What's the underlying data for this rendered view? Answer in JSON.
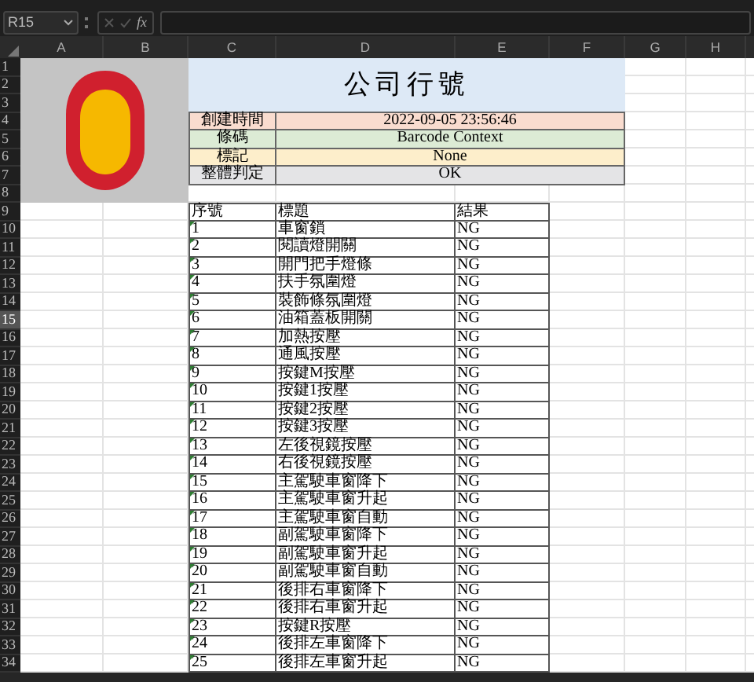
{
  "name_box": {
    "value": "R15"
  },
  "formula_bar": {
    "function_label": "fx"
  },
  "column_headers": [
    "A",
    "B",
    "C",
    "D",
    "E",
    "F",
    "G",
    "H"
  ],
  "row_headers": [
    {
      "label": "1",
      "selected": false
    },
    {
      "label": "2",
      "selected": false
    },
    {
      "label": "3",
      "selected": false
    },
    {
      "label": "4",
      "selected": false
    },
    {
      "label": "5",
      "selected": false
    },
    {
      "label": "6",
      "selected": false
    },
    {
      "label": "7",
      "selected": false
    },
    {
      "label": "8",
      "selected": false
    },
    {
      "label": "9",
      "selected": false
    },
    {
      "label": "10",
      "selected": false
    },
    {
      "label": "11",
      "selected": false
    },
    {
      "label": "12",
      "selected": false
    },
    {
      "label": "13",
      "selected": false
    },
    {
      "label": "14",
      "selected": false
    },
    {
      "label": "15",
      "selected": true
    },
    {
      "label": "16",
      "selected": false
    },
    {
      "label": "17",
      "selected": false
    },
    {
      "label": "18",
      "selected": false
    },
    {
      "label": "19",
      "selected": false
    },
    {
      "label": "20",
      "selected": false
    },
    {
      "label": "21",
      "selected": false
    },
    {
      "label": "22",
      "selected": false
    },
    {
      "label": "23",
      "selected": false
    },
    {
      "label": "24",
      "selected": false
    },
    {
      "label": "25",
      "selected": false
    },
    {
      "label": "26",
      "selected": false
    },
    {
      "label": "27",
      "selected": false
    },
    {
      "label": "28",
      "selected": false
    },
    {
      "label": "29",
      "selected": false
    },
    {
      "label": "30",
      "selected": false
    },
    {
      "label": "31",
      "selected": false
    },
    {
      "label": "32",
      "selected": false
    },
    {
      "label": "33",
      "selected": false
    },
    {
      "label": "34",
      "selected": false
    }
  ],
  "title": "公司行號",
  "info": [
    {
      "label": "創建時間",
      "value": "2022-09-05 23:56:46",
      "color": "#f9dccf"
    },
    {
      "label": "條碼",
      "value": "Barcode Context",
      "color": "#dcebd5"
    },
    {
      "label": "標記",
      "value": "None",
      "color": "#fdeecb"
    },
    {
      "label": "整體判定",
      "value": "OK",
      "color": "#e4e4e6"
    }
  ],
  "table": {
    "columns": [
      "序號",
      "標題",
      "結果"
    ],
    "rows": [
      [
        "1",
        "車窗鎖",
        "NG"
      ],
      [
        "2",
        "閱讀燈開關",
        "NG"
      ],
      [
        "3",
        "開門把手燈條",
        "NG"
      ],
      [
        "4",
        "扶手氛圍燈",
        "NG"
      ],
      [
        "5",
        "裝飾條氛圍燈",
        "NG"
      ],
      [
        "6",
        "油箱蓋板開關",
        "NG"
      ],
      [
        "7",
        "加熱按壓",
        "NG"
      ],
      [
        "8",
        "通風按壓",
        "NG"
      ],
      [
        "9",
        "按鍵M按壓",
        "NG"
      ],
      [
        "10",
        "按鍵1按壓",
        "NG"
      ],
      [
        "11",
        "按鍵2按壓",
        "NG"
      ],
      [
        "12",
        "按鍵3按壓",
        "NG"
      ],
      [
        "13",
        "左後視鏡按壓",
        "NG"
      ],
      [
        "14",
        "右後視鏡按壓",
        "NG"
      ],
      [
        "15",
        "主駕駛車窗降下",
        "NG"
      ],
      [
        "16",
        "主駕駛車窗升起",
        "NG"
      ],
      [
        "17",
        "主駕駛車窗自動",
        "NG"
      ],
      [
        "18",
        "副駕駛車窗降下",
        "NG"
      ],
      [
        "19",
        "副駕駛車窗升起",
        "NG"
      ],
      [
        "20",
        "副駕駛車窗自動",
        "NG"
      ],
      [
        "21",
        "後排右車窗降下",
        "NG"
      ],
      [
        "22",
        "後排右車窗升起",
        "NG"
      ],
      [
        "23",
        "按鍵R按壓",
        "NG"
      ],
      [
        "24",
        "後排左車窗降下",
        "NG"
      ],
      [
        "25",
        "後排左車窗升起",
        "NG"
      ]
    ]
  }
}
